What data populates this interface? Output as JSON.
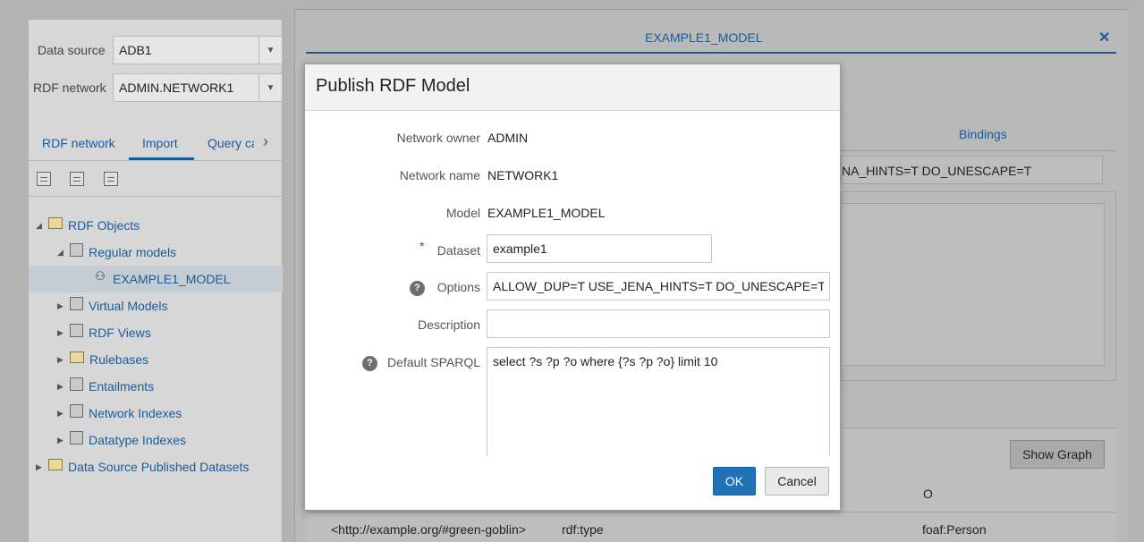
{
  "left_panel": {
    "data_source_label": "Data source",
    "data_source_value": "ADB1",
    "rdf_network_label": "RDF network",
    "rdf_network_value": "ADMIN.NETWORK1",
    "tabs": [
      {
        "label": "RDF network"
      },
      {
        "label": "Import"
      },
      {
        "label": "Query ca"
      }
    ],
    "tree": {
      "root": "RDF Objects",
      "regular_models": "Regular models",
      "model": "EXAMPLE1_MODEL",
      "virtual_models": "Virtual Models",
      "rdf_views": "RDF Views",
      "rulebases": "Rulebases",
      "entailments": "Entailments",
      "network_indexes": "Network Indexes",
      "datatype_indexes": "Datatype Indexes",
      "published_datasets": "Data Source Published Datasets"
    }
  },
  "background": {
    "doc_tab_title": "EXAMPLE1_MODEL",
    "close_glyph": "✕",
    "bindings_tab": "Bindings",
    "options_field_partial": "NA_HINTS=T DO_UNESCAPE=T",
    "show_graph_button": "Show Graph",
    "result_column_o": "O",
    "result_row": {
      "subject": "<http://example.org/#green-goblin>",
      "predicate": "rdf:type",
      "object": "foaf:Person"
    }
  },
  "dialog": {
    "title": "Publish RDF Model",
    "network_owner_label": "Network owner",
    "network_owner_value": "ADMIN",
    "network_name_label": "Network name",
    "network_name_value": "NETWORK1",
    "model_label": "Model",
    "model_value": "EXAMPLE1_MODEL",
    "required_marker": "*",
    "dataset_label": "Dataset",
    "dataset_value": "example1",
    "options_label": "Options",
    "options_value": "ALLOW_DUP=T USE_JENA_HINTS=T DO_UNESCAPE=T",
    "description_label": "Description",
    "description_value": "",
    "default_sparql_label": "Default SPARQL",
    "default_sparql_value": "select ?s ?p ?o where {?s ?p ?o} limit 10",
    "ok_button": "OK",
    "cancel_button": "Cancel"
  }
}
